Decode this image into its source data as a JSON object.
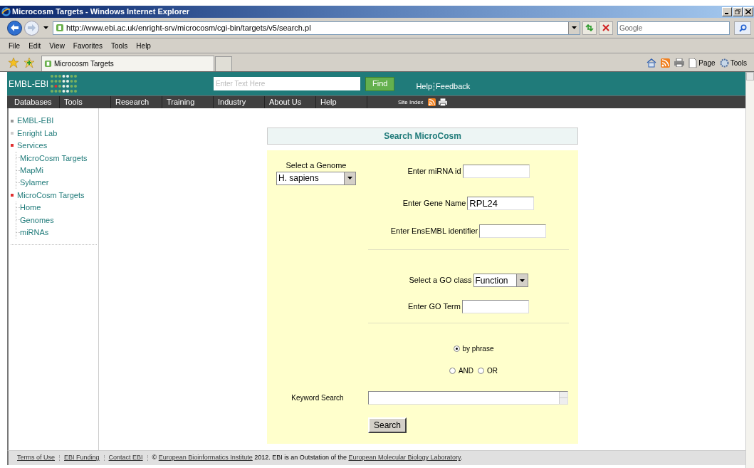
{
  "window": {
    "title": "Microcosm Targets - Windows Internet Explorer"
  },
  "address_bar": {
    "url": "http://www.ebi.ac.uk/enright-srv/microcosm/cgi-bin/targets/v5/search.pl"
  },
  "browser_search": {
    "placeholder": "Google"
  },
  "menu_bar": [
    "File",
    "Edit",
    "View",
    "Favorites",
    "Tools",
    "Help"
  ],
  "browser_tab": {
    "title": "Microcosm Targets"
  },
  "command_bar": [
    "Page",
    "Tools"
  ],
  "site_header": {
    "logo": "EMBL-EBI",
    "search_placeholder": "Enter Text Here",
    "find_button": "Find",
    "links": [
      "Help",
      "Feedback"
    ]
  },
  "nav": [
    "Databases",
    "Tools",
    "Research",
    "Training",
    "Industry",
    "About Us",
    "Help"
  ],
  "site_index": "Site Index",
  "sidebar": [
    {
      "label": "EMBL-EBI",
      "color": "#999999"
    },
    {
      "label": "Enright Lab",
      "color": "#cccccc"
    },
    {
      "label": "Services",
      "color": "#e03030",
      "children": [
        {
          "label": "MicroCosm Targets"
        },
        {
          "label": "MapMi"
        },
        {
          "label": "Sylamer"
        }
      ]
    },
    {
      "label": "MicroCosm Targets",
      "color": "#e03030",
      "children": [
        {
          "label": "Home"
        },
        {
          "label": "Genomes"
        },
        {
          "label": "miRNAs"
        }
      ]
    }
  ],
  "form": {
    "title": "Search MicroCosm",
    "genome": {
      "label": "Select a Genome",
      "value": "H. sapiens"
    },
    "mirna": {
      "label": "Enter miRNA id"
    },
    "gene": {
      "label": "Enter Gene Name",
      "value": "RPL24"
    },
    "ensembl": {
      "label": "Enter EnsEMBL identifier"
    },
    "go_class": {
      "label": "Select a GO class",
      "value": "Function"
    },
    "go_term": {
      "label": "Enter GO Term"
    },
    "match_mode": [
      {
        "label": "by phrase",
        "selected": true
      },
      {
        "label": "AND",
        "selected": false
      },
      {
        "label": "OR",
        "selected": false
      }
    ],
    "keyword": {
      "label": "Keyword Search"
    },
    "search_button": "Search"
  },
  "footer": {
    "links": [
      "Terms of Use",
      "EBI Funding",
      "Contact EBI"
    ],
    "copyright": {
      "symbol": "©",
      "link1": "European Bioinformatics Institute",
      "middle": "2012. EBI is an Outstation of the",
      "link2": "European Molecular Biology Laboratory",
      "end": "."
    }
  }
}
